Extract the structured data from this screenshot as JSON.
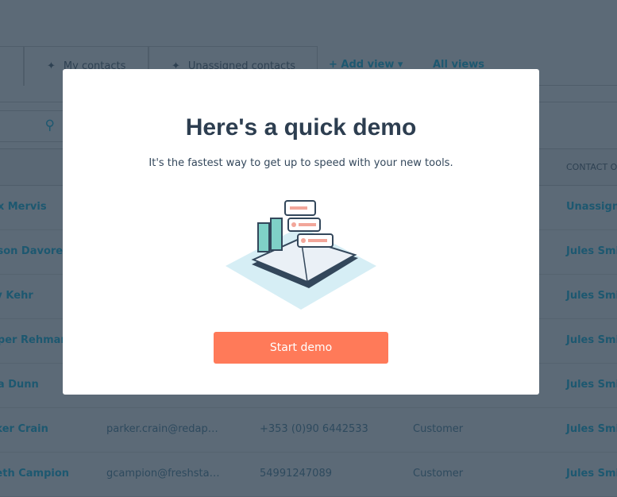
{
  "tabs": [
    {
      "label": "My contacts",
      "icon": "pin-icon"
    },
    {
      "label": "Unassigned contacts",
      "icon": "pin-icon"
    }
  ],
  "add_view": "+ Add view ▾",
  "all_views": "All views",
  "table": {
    "header_partial": "CONTACT O",
    "rows": [
      [
        "ex Mervis",
        "",
        "",
        "",
        "Unassigned"
      ],
      [
        "yson Davoren",
        "",
        "",
        "",
        "Jules Smith"
      ],
      [
        "ry Kehr",
        "",
        "",
        "",
        "Jules Smith"
      ],
      [
        "oper Rehman",
        "",
        "",
        "",
        "Jules Smith"
      ],
      [
        "lia Dunn",
        "",
        "",
        "",
        "Jules Smith"
      ],
      [
        "rker Crain",
        "parker.crain@redap…",
        "+353 (0)90 6442533",
        "Customer",
        "Jules Smith"
      ],
      [
        "reth Campion",
        "gcampion@freshsta…",
        "54991247089",
        "Customer",
        "Jules Smith"
      ]
    ]
  },
  "modal": {
    "title": "Here's a quick demo",
    "subtitle": "It's the fastest way to get up to speed with your new tools.",
    "button": "Start demo",
    "accent": "#ff7a59"
  }
}
